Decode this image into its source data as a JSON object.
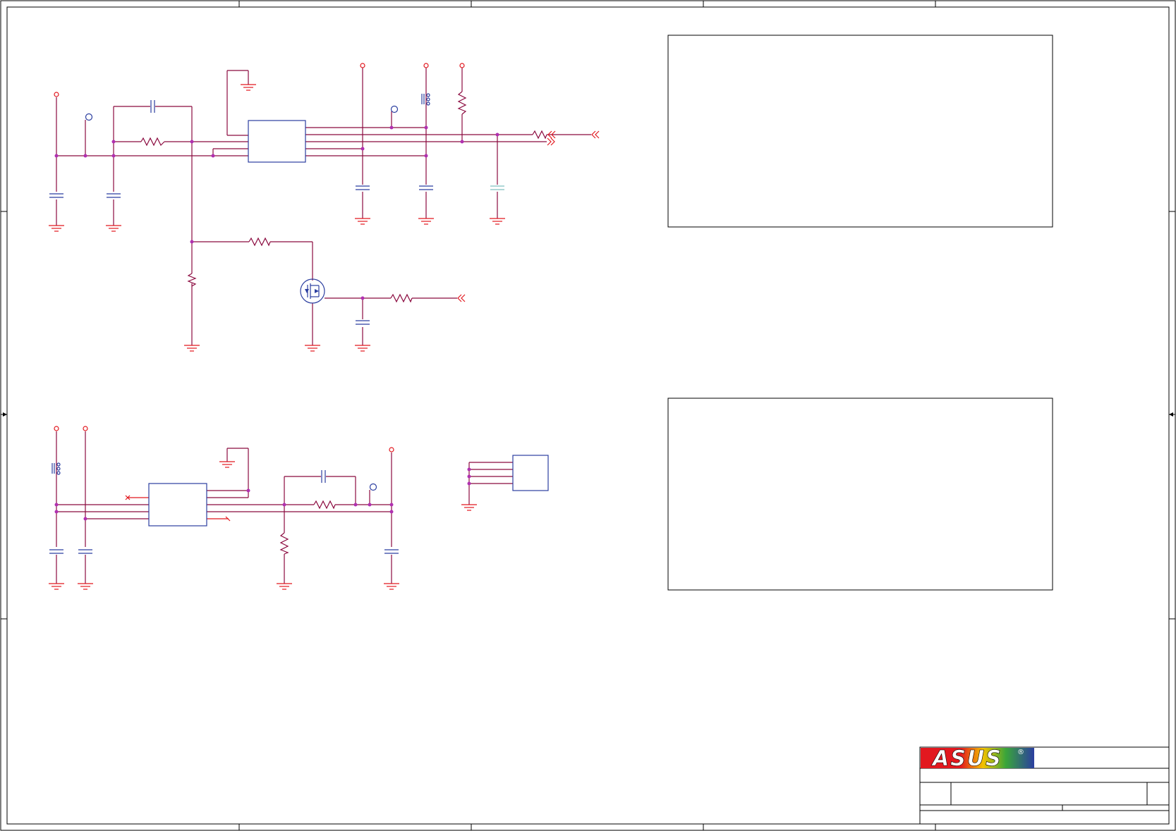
{
  "sheet": {
    "border_color": "#000000",
    "wire_color": "#8b0a3f",
    "net_color": "#e2181f",
    "part_color": "#2b3ea0",
    "junction_color": "#b030b0"
  },
  "title_block": {
    "logo_text": "ASUS",
    "logo_mark": "®",
    "logo_bg_left": "#e2181f",
    "logo_bg_right": "#2b3ea0",
    "title": "",
    "size": "",
    "doc_number": "",
    "rev": "",
    "date": "",
    "sheet": ""
  },
  "note_boxes": [
    {
      "id": "note-box-top",
      "text": ""
    },
    {
      "id": "note-box-bottom",
      "text": ""
    }
  ]
}
